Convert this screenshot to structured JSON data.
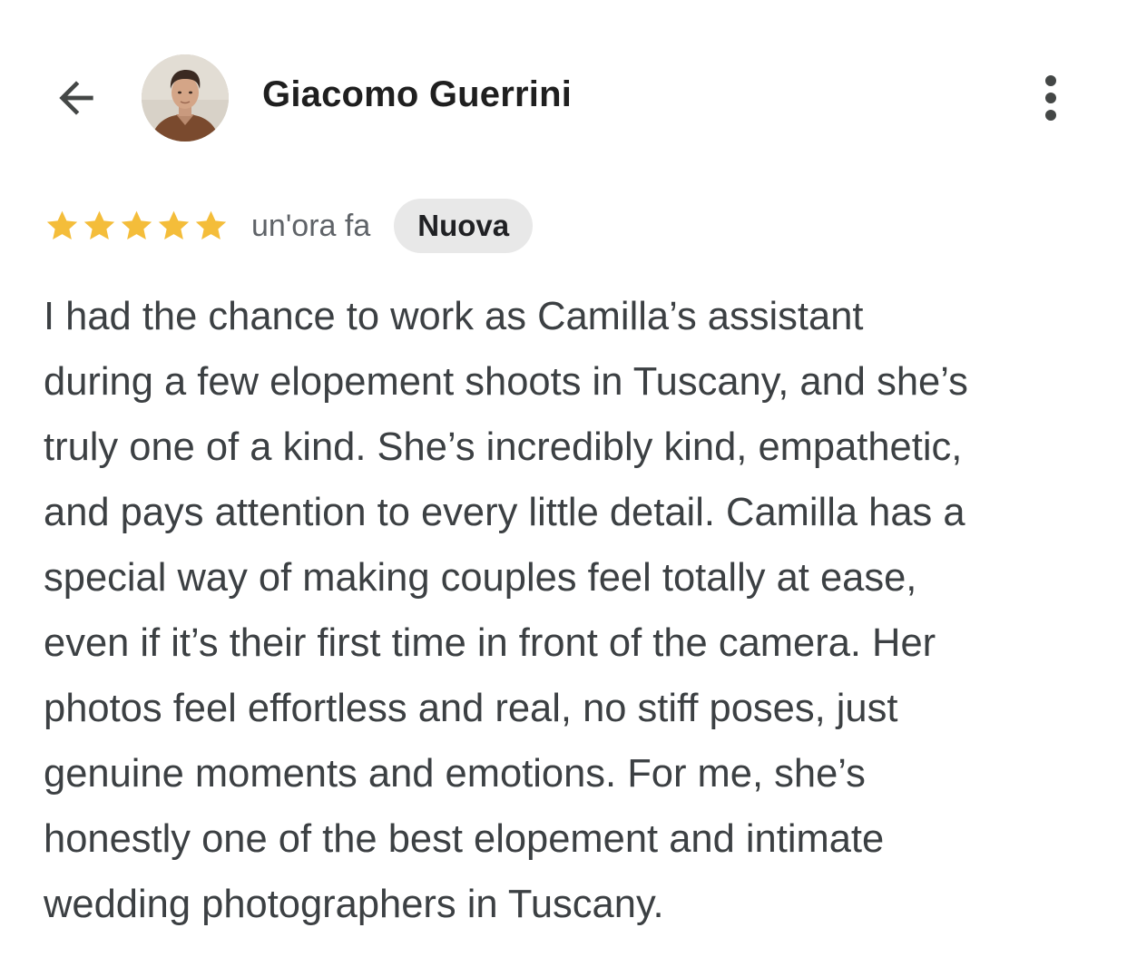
{
  "header": {
    "back_icon": "arrow-left-icon",
    "user_name": "Giacomo Guerrini",
    "avatar_alt": "Giacomo Guerrini",
    "more_icon": "more-vertical-icon"
  },
  "review": {
    "rating": 5,
    "rating_max": 5,
    "star_color": "#f4bd3a",
    "time_ago": "un'ora fa",
    "badge": "Nuova",
    "text": "I had the chance to work as Camilla’s assistant\nduring a few elopement shoots in Tuscany, and she’s\ntruly one of a kind. She’s incredibly kind, empathetic,\nand pays attention to every little detail. Camilla has a\nspecial way of making couples feel totally at ease,\neven if it’s their first time in front of the camera. Her\nphotos feel effortless and real, no stiff poses, just\ngenuine moments and emotions. For me, she’s\nhonestly one of the best elopement and intimate\nwedding photographers in Tuscany."
  }
}
